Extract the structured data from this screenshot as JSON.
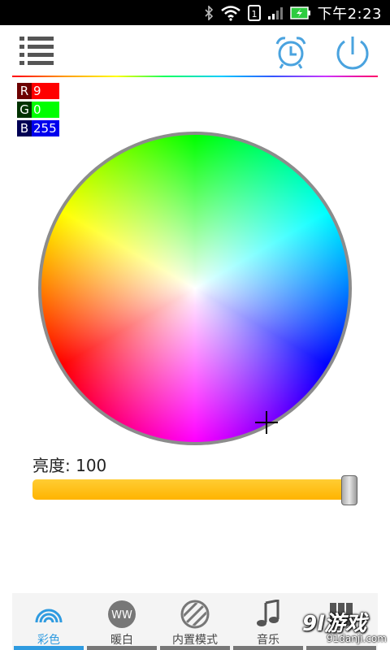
{
  "status_bar": {
    "time": "下午2:23",
    "icons": [
      "bluetooth-icon",
      "wifi-icon",
      "sim-icon",
      "signal-icon",
      "battery-charging-icon"
    ]
  },
  "header": {
    "menu_icon": "list-menu-icon",
    "alarm_icon": "alarm-clock-icon",
    "power_icon": "power-icon",
    "accent_color": "#4aa3df"
  },
  "rgb": {
    "r_label": "R",
    "r_value": "9",
    "g_label": "G",
    "g_value": "0",
    "b_label": "B",
    "b_value": "255"
  },
  "brightness": {
    "label": "亮度: 100",
    "value": 100,
    "max": 100,
    "color": "#ffbe1a"
  },
  "tabs": [
    {
      "label": "彩色",
      "icon": "rainbow-icon",
      "active": true
    },
    {
      "label": "暖白",
      "icon": "ww-circle-icon",
      "badge": "WW",
      "active": false
    },
    {
      "label": "内置模式",
      "icon": "striped-circle-icon",
      "active": false
    },
    {
      "label": "音乐",
      "icon": "music-note-icon",
      "active": false
    },
    {
      "label": "",
      "icon": "grid-icon",
      "active": false
    }
  ],
  "watermark": {
    "main": "9l游戏",
    "sub": "91danji.com"
  }
}
